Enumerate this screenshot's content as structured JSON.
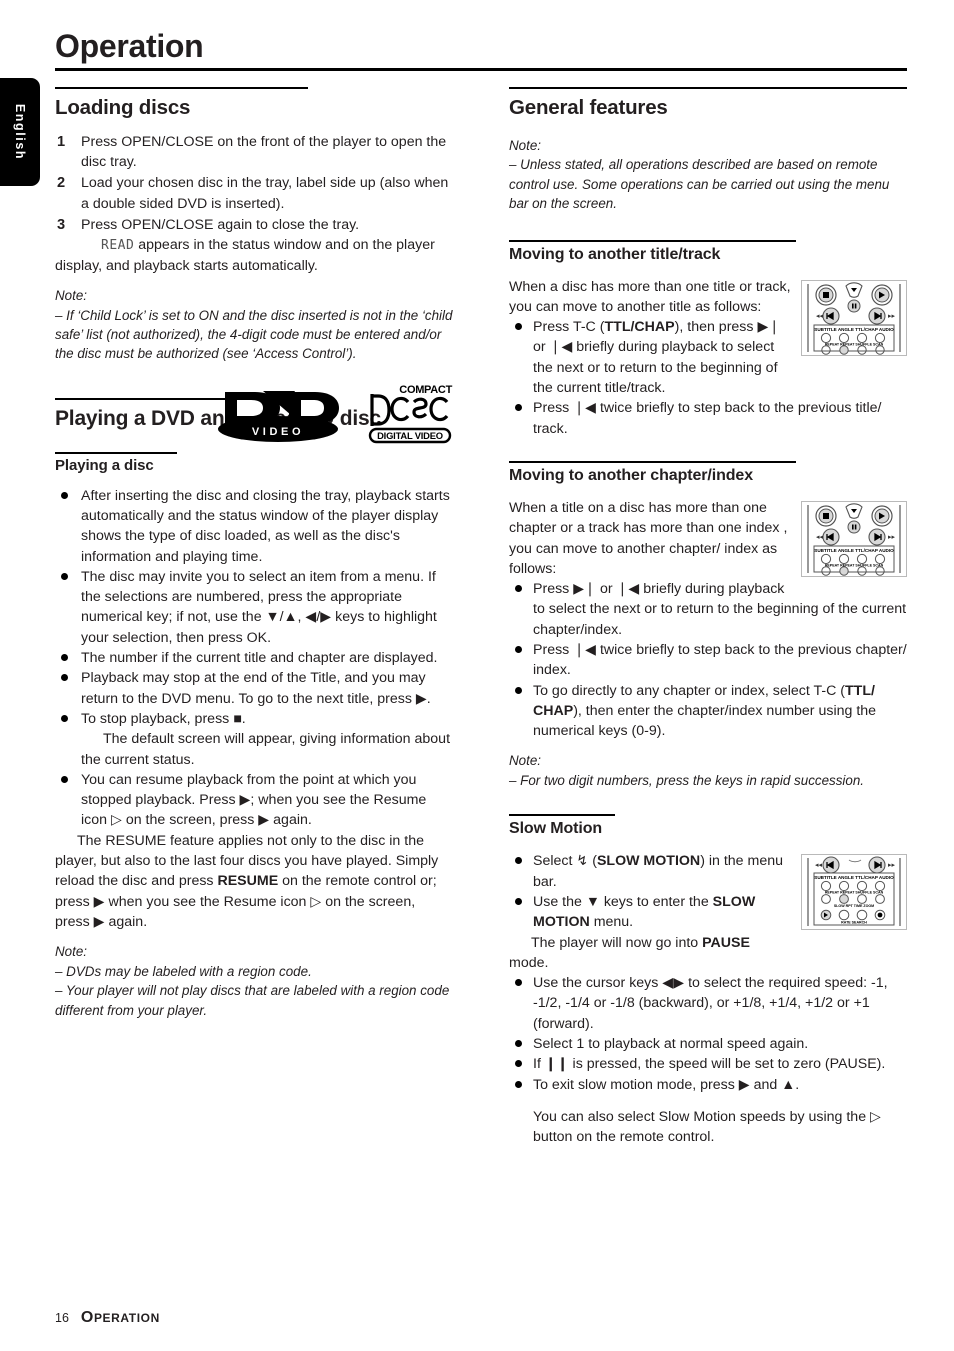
{
  "sidebar": {
    "language_tab": "English"
  },
  "header": {
    "title": "Operation"
  },
  "left_column": {
    "loading_discs": {
      "title": "Loading discs",
      "steps": [
        {
          "num": "1",
          "text": "Press OPEN/CLOSE on the front of the player to open the disc tray."
        },
        {
          "num": "2",
          "text": "Load your chosen disc in the tray, label side up (also when a double sided DVD is inserted)."
        },
        {
          "num": "3",
          "text": "Press OPEN/CLOSE again to close the tray."
        }
      ],
      "step3_sub_lcd": "READ",
      "step3_sub_rest": " appears in the status window and on the player",
      "step3_sub_cont": "display, and playback starts automatically.",
      "note": {
        "head": "Note:",
        "lines": [
          "–  If ‘Child Lock’ is set to ON and the disc inserted is not in the ‘child safe’ list (not authorized), the 4-digit code must be entered and/or the disc must be authorized (see ‘Access Control’)."
        ]
      }
    },
    "playing_dvd": {
      "title": "Playing a DVD and Video CD disc",
      "logos": [
        {
          "name": "dvd-video-logo",
          "top": "DVD",
          "bottom": "VIDEO"
        },
        {
          "name": "compact-disc-digital-video-logo",
          "top": "COMPACT",
          "middle": "disc",
          "bottom": "DIGITAL VIDEO"
        }
      ],
      "sub_title": "Playing a disc",
      "bullets": [
        "After inserting the disc and closing the tray, playback starts automatically and the status window of the player display shows the type of disc loaded, as well as the disc's information and playing time.",
        "The disc may invite you to select an item from a menu. If the selections are numbered, press the appropriate numerical key; if not, use the ▼/▲, ◀/▶ keys to highlight your selection, then press OK.",
        "The number if the current title and chapter are displayed.",
        "Playback may stop at the end of the Title, and you may return to the DVD menu. To go to the next title, press ▶.",
        "To stop playback, press ■.",
        "You can resume playback from the point at which you stopped playback. Press ▶; when you see the Resume icon ▷ on the screen, press ▶ again."
      ],
      "bullet5_sub": "The default screen will appear, giving information about the current status.",
      "bullet6_sub_pre": "The RESUME feature applies not only to the disc in the player, but also to the last four discs you have played. Simply reload the disc and press ",
      "bullet6_sub_bold": "RESUME",
      "bullet6_sub_post": " on the remote control or; press ▶ when you see the Resume icon ▷ on the screen, press ▶ again.",
      "note": {
        "head": "Note:",
        "lines": [
          "–  DVDs may be labeled with a region code.",
          "–  Your player will not play discs that are labeled with a region code different from your player."
        ]
      }
    }
  },
  "right_column": {
    "general_features": {
      "title": "General features",
      "note": {
        "head": "Note:",
        "lines": [
          "–  Unless stated, all operations described are based on remote control use.  Some operations can be carried out using the menu bar on the screen."
        ]
      }
    },
    "moving_title_track": {
      "title": "Moving to another title/track",
      "intro": "When a disc has more than one title or track, you can move to another title as follows:",
      "bullets": [
        {
          "pre": "Press T-C (",
          "bold": "TTL/CHAP",
          "post": "), then press ▶❘ or ❘◀ briefly during playback to select the next or to return to the beginning of the current title/track."
        },
        {
          "pre": "Press ❘◀ twice briefly to step back to the previous title/ track.",
          "bold": "",
          "post": ""
        }
      ],
      "remote_image": "remote-control-transport-keys"
    },
    "moving_chapter_index": {
      "title": "Moving to another chapter/index",
      "intro": "When a title on a disc has more than one chapter or a track has more than one index , you can move to another chapter/ index as follows:",
      "bullets": [
        {
          "pre": "Press ▶❘ or ❘◀ briefly during playback to select the next or to return to the beginning of the current chapter/index.",
          "bold": "",
          "post": ""
        },
        {
          "pre": "Press ❘◀ twice briefly to step back to the previous chapter/ index.",
          "bold": "",
          "post": ""
        },
        {
          "pre": "To go directly to any chapter or index, select T-C (",
          "bold": "TTL/ CHAP",
          "post": "), then enter the chapter/index number using the numerical keys (0-9)."
        }
      ],
      "note": {
        "head": "Note:",
        "lines": [
          "–  For two digit numbers, press the keys in rapid succession."
        ]
      },
      "remote_image": "remote-control-transport-keys"
    },
    "slow_motion": {
      "title": "Slow Motion",
      "bullets": [
        {
          "pre": "Select ↯ (",
          "bold": "SLOW MOTION",
          "post": ") in the menu bar."
        },
        {
          "pre": "Use the ▼ keys to enter the ",
          "bold": "SLOW MOTION",
          "post": " menu."
        },
        {
          "pre": "Use the cursor keys ◀▶ to select the required speed: -1, -1/2, -1/4 or -1/8 (backward), or +1/8, +1/4, +1/2 or +1 (forward).",
          "bold": "",
          "post": ""
        },
        {
          "pre": "Select 1 to playback at normal speed again.",
          "bold": "",
          "post": ""
        },
        {
          "pre": "If ❙❙ is pressed, the speed will be set to zero (PAUSE).",
          "bold": "",
          "post": ""
        },
        {
          "pre": "To exit slow motion mode, press ▶ and ▲.",
          "bold": "",
          "post": ""
        }
      ],
      "bullet2_sub_pre": "The player will now go into ",
      "bullet2_sub_bold": "PAUSE",
      "bullet2_sub_post": " mode.",
      "closing": "You can also select Slow Motion speeds by using the ▷ button on the remote control.",
      "remote_image": "remote-control-function-keys"
    }
  },
  "footer": {
    "page_number": "16",
    "chapter_first": "O",
    "chapter_rest": "PERATION"
  },
  "colors": {
    "ink": "#231f20",
    "rule": "#000000",
    "tab_bg": "#000000",
    "tab_text": "#ffffff"
  }
}
